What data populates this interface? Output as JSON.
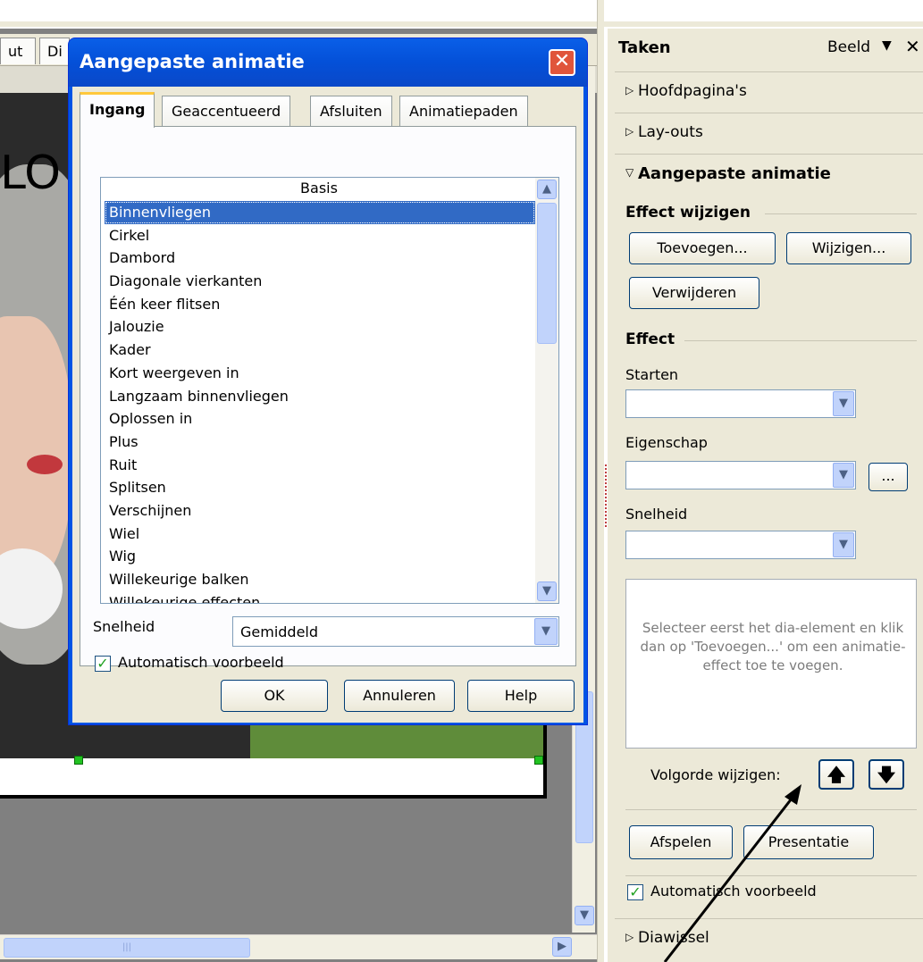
{
  "editor": {
    "doc_tabs": [
      "ut",
      "Di"
    ],
    "slide_title_fragment": "LO"
  },
  "dialog": {
    "title": "Aangepaste animatie",
    "tabs": [
      "Ingang",
      "Geaccentueerd",
      "Afsluiten",
      "Animatiepaden"
    ],
    "active_tab": "Ingang",
    "list_header": "Basis",
    "list_items": [
      "Binnenvliegen",
      "Cirkel",
      "Dambord",
      "Diagonale vierkanten",
      "Één keer flitsen",
      "Jalouzie",
      "Kader",
      "Kort weergeven in",
      "Langzaam binnenvliegen",
      "Oplossen in",
      "Plus",
      "Ruit",
      "Splitsen",
      "Verschijnen",
      "Wiel",
      "Wig",
      "Willekeurige balken",
      "Willekeurige effecten"
    ],
    "selected_item": "Binnenvliegen",
    "speed_label": "Snelheid",
    "speed_value": "Gemiddeld",
    "auto_preview_label": "Automatisch voorbeeld",
    "auto_preview_checked": true,
    "ok_label": "OK",
    "cancel_label": "Annuleren",
    "help_label": "Help"
  },
  "taskpane": {
    "title": "Taken",
    "view_label": "Beeld",
    "sections": {
      "master_pages": "Hoofdpagina's",
      "layouts": "Lay-outs",
      "custom_animation": "Aangepaste animatie",
      "slide_transition": "Diawissel"
    },
    "modify_effect_title": "Effect wijzigen",
    "add_button": "Toevoegen...",
    "change_button": "Wijzigen...",
    "remove_button": "Verwijderen",
    "effect_title": "Effect",
    "start_label": "Starten",
    "property_label": "Eigenschap",
    "property_more": "...",
    "speed_label": "Snelheid",
    "info_text": "Selecteer eerst het dia-element en klik dan op 'Toevoegen...' om een animatie-effect toe te voegen.",
    "change_order_label": "Volgorde wijzigen:",
    "play_button": "Afspelen",
    "presentation_button": "Presentatie",
    "auto_preview_label": "Automatisch voorbeeld",
    "auto_preview_checked": true
  },
  "colors": {
    "dialog_titlebar": "#0450d8",
    "selection": "#316ac5",
    "panel_bg": "#ece9d8"
  }
}
